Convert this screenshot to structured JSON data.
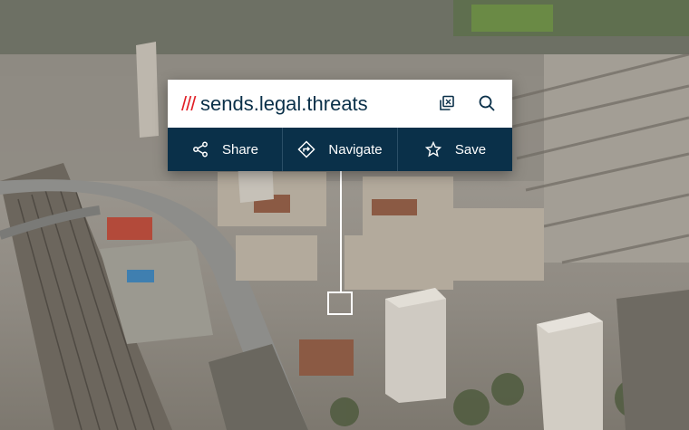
{
  "address": {
    "slashes": "///",
    "words": "sends.legal.threats"
  },
  "icons": {
    "copy": "copy-icon",
    "search": "search-icon",
    "share": "share-icon",
    "navigate": "navigate-icon",
    "save": "star-icon"
  },
  "actions": {
    "share_label": "Share",
    "navigate_label": "Navigate",
    "save_label": "Save"
  },
  "colors": {
    "brand_navy": "#0a3049",
    "brand_red": "#e11f26",
    "marker": "#ffffff"
  }
}
